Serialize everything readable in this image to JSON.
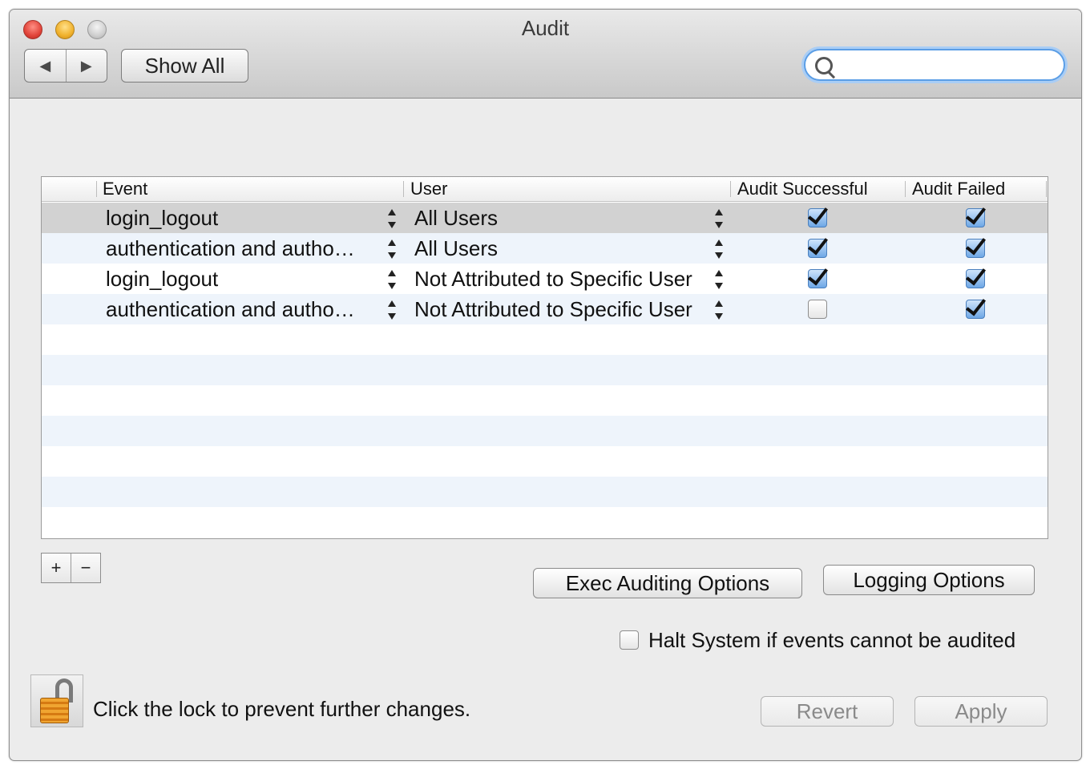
{
  "window": {
    "title": "Audit"
  },
  "toolbar": {
    "back_glyph": "◀",
    "forward_glyph": "▶",
    "show_all_label": "Show All",
    "search_placeholder": ""
  },
  "table": {
    "columns": [
      "Event",
      "User",
      "Audit Successful",
      "Audit Failed"
    ],
    "rows": [
      {
        "event": "login_logout",
        "user": "All Users",
        "audit_successful": true,
        "audit_failed": true,
        "selected": true
      },
      {
        "event": "authentication and autho…",
        "user": "All Users",
        "audit_successful": true,
        "audit_failed": true
      },
      {
        "event": "login_logout",
        "user": "Not Attributed to Specific User",
        "audit_successful": true,
        "audit_failed": true
      },
      {
        "event": "authentication and autho…",
        "user": "Not Attributed to Specific User",
        "audit_successful": false,
        "audit_failed": true
      }
    ]
  },
  "controls": {
    "add_label": "+",
    "remove_label": "−",
    "exec_auditing_label": "Exec Auditing Options",
    "logging_options_label": "Logging Options",
    "halt_label": "Halt System if events cannot be audited",
    "halt_checked": false,
    "revert_label": "Revert",
    "apply_label": "Apply"
  },
  "footer": {
    "lock_text": "Click the lock to prevent further changes."
  },
  "colors": {
    "selection": "#d2d2d2",
    "alt_row": "#eef4fb",
    "search_focus": "#5b9ee6"
  }
}
